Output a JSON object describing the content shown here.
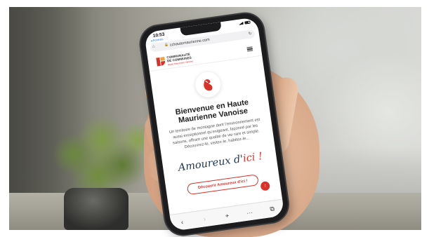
{
  "status_bar": {
    "time": "10:53",
    "back_app": "◂ Formats"
  },
  "browser": {
    "url": "cchautemaurienne.com",
    "home_icon": "home-icon",
    "lock_icon": "lock-icon",
    "reload_icon": "reload-icon",
    "toolbar": [
      {
        "icon": "back-icon",
        "glyph": "‹"
      },
      {
        "icon": "forward-icon",
        "glyph": "›"
      },
      {
        "icon": "add-tab-icon",
        "glyph": "+"
      },
      {
        "icon": "more-icon",
        "glyph": "···"
      },
      {
        "icon": "tabs-icon",
        "glyph": "⧉"
      }
    ]
  },
  "site": {
    "logo_line1": "COMMUNAUTÉ",
    "logo_line2": "DE COMMUNES",
    "logo_sub": "Haute Maurienne Vanoise",
    "menu_icon": "hamburger-menu-icon",
    "hero_title": "Bienvenue en Haute Maurienne Vanoise",
    "hero_text": "Un territoire de montagne dont l’environnement est aussi exceptionnel qu’exigeant, façonné par les saisons, offrant une qualité de vie rare et simple. Découvrez-le, visitez-le, habitez-le...",
    "script_main": "Amoureux d'",
    "script_accent": "ici !",
    "cta_label": "Découvrir Amoureux d'ici !",
    "fab_icon": "arrow-up-icon",
    "fab_glyph": "↑"
  },
  "colors": {
    "brand_red": "#d8332a",
    "brand_orange": "#f2a23a",
    "navy": "#1f3552"
  }
}
